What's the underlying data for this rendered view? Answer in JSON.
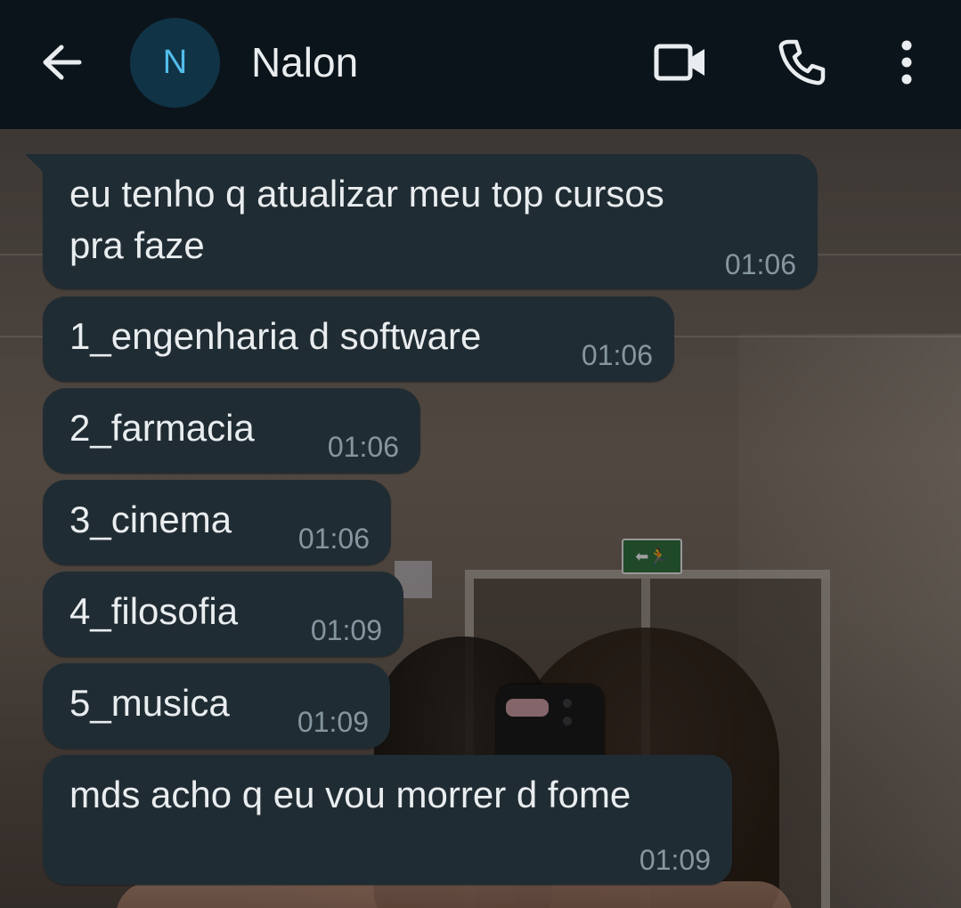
{
  "header": {
    "back_icon": "arrow-left-icon",
    "avatar_initial": "N",
    "contact_name": "Nalon",
    "video_icon": "video-camera-icon",
    "call_icon": "phone-icon",
    "menu_icon": "more-vertical-icon"
  },
  "wallpaper": {
    "exit_sign": "⬅🏃"
  },
  "messages": [
    {
      "lines": [
        "eu tenho q atualizar meu top cursos",
        "pra faze"
      ],
      "time": "01:06"
    },
    {
      "lines": [
        "1_engenharia d software"
      ],
      "time": "01:06"
    },
    {
      "lines": [
        "2_farmacia"
      ],
      "time": "01:06"
    },
    {
      "lines": [
        "3_cinema"
      ],
      "time": "01:06"
    },
    {
      "lines": [
        "4_filosofia"
      ],
      "time": "01:09"
    },
    {
      "lines": [
        "5_musica"
      ],
      "time": "01:09"
    },
    {
      "lines": [
        "mds acho q eu vou morrer d fome"
      ],
      "time": "01:09"
    }
  ],
  "colors": {
    "header_bg": "#0b141a",
    "bubble_bg": "#202c33",
    "text": "#e9edef",
    "timestamp": "#8696a0",
    "avatar_bg": "#103346",
    "avatar_text": "#53bdeb"
  }
}
